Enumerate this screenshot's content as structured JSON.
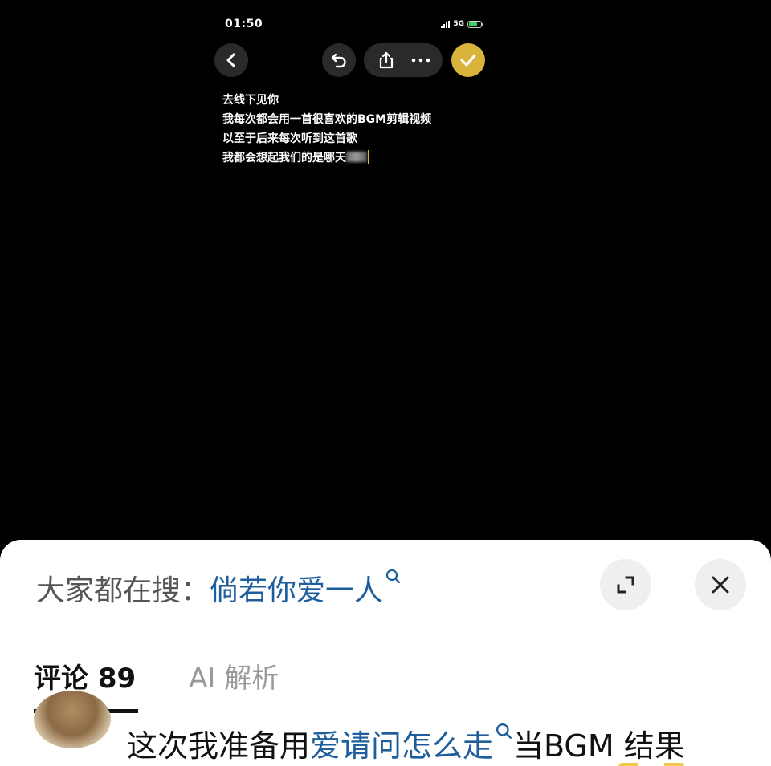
{
  "status_bar": {
    "time": "01:50",
    "network": "5G"
  },
  "note": {
    "lines": [
      "去线下见你",
      "我每次都会用一首很喜欢的BGM剪辑视频",
      "以至于后来每次听到这首歌"
    ],
    "last_line_prefix": "我都会想起我们的是哪天"
  },
  "sheet": {
    "search_prefix": "大家都在搜：",
    "search_term": "倘若你爱一人",
    "tabs": [
      {
        "label": "评论 89",
        "active": true
      },
      {
        "label": "AI 解析",
        "active": false
      }
    ],
    "comment": {
      "text_before": "这次我准备用",
      "link_text": "爱请问怎么走",
      "text_after": "当BGM 结果"
    }
  },
  "icons": {
    "back": "chevron-left-icon",
    "undo": "undo-icon",
    "share": "share-icon",
    "more": "more-dots-icon",
    "done": "checkmark-icon",
    "search": "search-icon",
    "expand": "expand-icon",
    "close": "close-icon"
  },
  "colors": {
    "link": "#1f5e9c",
    "done_button": "#d9b43c",
    "caret": "#f0c52b",
    "battery": "#3bd160"
  }
}
